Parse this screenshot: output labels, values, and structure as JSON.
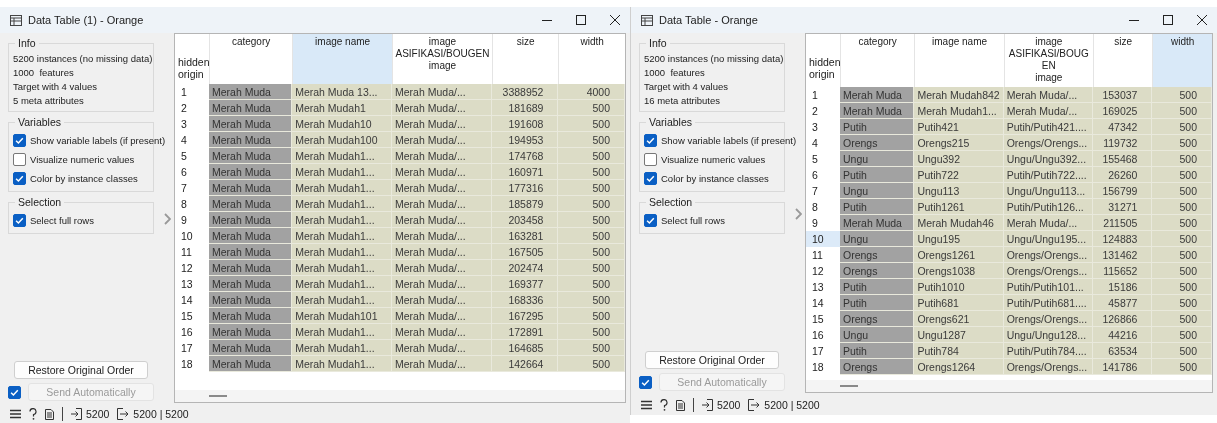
{
  "windows": [
    {
      "title": "Data Table (1) - Orange",
      "info": {
        "title": "Info",
        "lines": [
          "5200 instances (no missing data)",
          "1000  features",
          "Target with 4 values",
          "5 meta attributes"
        ]
      },
      "variables": {
        "title": "Variables",
        "options": [
          {
            "label": "Show variable labels (if present)",
            "checked": true
          },
          {
            "label": "Visualize numeric values",
            "checked": false
          },
          {
            "label": "Color by instance classes",
            "checked": true
          }
        ]
      },
      "selection": {
        "title": "Selection",
        "options": [
          {
            "label": "Select full rows",
            "checked": true
          }
        ]
      },
      "restore_button": "Restore Original Order",
      "send_automatically": {
        "label": "Send Automatically",
        "checked": true,
        "disabled": true
      },
      "table": {
        "row_header": "hidden origin",
        "columns": [
          {
            "lines": [
              "category"
            ],
            "kind": "class",
            "selected": false
          },
          {
            "lines": [
              "image name"
            ],
            "kind": "text",
            "selected": true
          },
          {
            "lines": [
              "image",
              "ASIFIKASI/BOUGEN",
              "image"
            ],
            "kind": "text",
            "selected": false
          },
          {
            "lines": [
              "size"
            ],
            "kind": "number",
            "selected": false
          },
          {
            "lines": [
              "width"
            ],
            "kind": "number",
            "selected": false
          }
        ],
        "rows": [
          {
            "number": "1",
            "selected": false,
            "cells": [
              "Merah Muda",
              "Merah Muda 13...",
              "Merah Muda/...",
              "3388952",
              "4000"
            ]
          },
          {
            "number": "2",
            "selected": false,
            "cells": [
              "Merah Muda",
              "Merah Mudah1",
              "Merah Muda/...",
              "181689",
              "500"
            ]
          },
          {
            "number": "3",
            "selected": false,
            "cells": [
              "Merah Muda",
              "Merah Mudah10",
              "Merah Muda/...",
              "191608",
              "500"
            ]
          },
          {
            "number": "4",
            "selected": false,
            "cells": [
              "Merah Muda",
              "Merah Mudah100",
              "Merah Muda/...",
              "194953",
              "500"
            ]
          },
          {
            "number": "5",
            "selected": false,
            "cells": [
              "Merah Muda",
              "Merah Mudah1...",
              "Merah Muda/...",
              "174768",
              "500"
            ]
          },
          {
            "number": "6",
            "selected": false,
            "cells": [
              "Merah Muda",
              "Merah Mudah1...",
              "Merah Muda/...",
              "160971",
              "500"
            ]
          },
          {
            "number": "7",
            "selected": false,
            "cells": [
              "Merah Muda",
              "Merah Mudah1...",
              "Merah Muda/...",
              "177316",
              "500"
            ]
          },
          {
            "number": "8",
            "selected": false,
            "cells": [
              "Merah Muda",
              "Merah Mudah1...",
              "Merah Muda/...",
              "185879",
              "500"
            ]
          },
          {
            "number": "9",
            "selected": false,
            "cells": [
              "Merah Muda",
              "Merah Mudah1...",
              "Merah Muda/...",
              "203458",
              "500"
            ]
          },
          {
            "number": "10",
            "selected": false,
            "cells": [
              "Merah Muda",
              "Merah Mudah1...",
              "Merah Muda/...",
              "163281",
              "500"
            ]
          },
          {
            "number": "11",
            "selected": false,
            "cells": [
              "Merah Muda",
              "Merah Mudah1...",
              "Merah Muda/...",
              "167505",
              "500"
            ]
          },
          {
            "number": "12",
            "selected": false,
            "cells": [
              "Merah Muda",
              "Merah Mudah1...",
              "Merah Muda/...",
              "202474",
              "500"
            ]
          },
          {
            "number": "13",
            "selected": false,
            "cells": [
              "Merah Muda",
              "Merah Mudah1...",
              "Merah Muda/...",
              "169377",
              "500"
            ]
          },
          {
            "number": "14",
            "selected": false,
            "cells": [
              "Merah Muda",
              "Merah Mudah1...",
              "Merah Muda/...",
              "168336",
              "500"
            ]
          },
          {
            "number": "15",
            "selected": false,
            "cells": [
              "Merah Muda",
              "Merah Mudah101",
              "Merah Muda/...",
              "167295",
              "500"
            ]
          },
          {
            "number": "16",
            "selected": false,
            "cells": [
              "Merah Muda",
              "Merah Mudah1...",
              "Merah Muda/...",
              "172891",
              "500"
            ]
          },
          {
            "number": "17",
            "selected": false,
            "cells": [
              "Merah Muda",
              "Merah Mudah1...",
              "Merah Muda/...",
              "164685",
              "500"
            ]
          },
          {
            "number": "18",
            "selected": false,
            "cells": [
              "Merah Muda",
              "Merah Mudah1...",
              "Merah Muda/...",
              "142664",
              "500"
            ]
          }
        ]
      },
      "status": {
        "input": "5200",
        "output": "5200 | 5200"
      }
    },
    {
      "title": "Data Table - Orange",
      "info": {
        "title": "Info",
        "lines": [
          "5200 instances (no missing data)",
          "1000  features",
          "Target with 4 values",
          "16 meta attributes"
        ]
      },
      "variables": {
        "title": "Variables",
        "options": [
          {
            "label": "Show variable labels (if present)",
            "checked": true
          },
          {
            "label": "Visualize numeric values",
            "checked": false
          },
          {
            "label": "Color by instance classes",
            "checked": true
          }
        ]
      },
      "selection": {
        "title": "Selection",
        "options": [
          {
            "label": "Select full rows",
            "checked": true
          }
        ]
      },
      "restore_button": "Restore Original Order",
      "send_automatically": {
        "label": "Send Automatically",
        "checked": true,
        "disabled": true
      },
      "table": {
        "row_header": "hidden origin",
        "columns": [
          {
            "lines": [
              "category"
            ],
            "kind": "class",
            "selected": false
          },
          {
            "lines": [
              "image name"
            ],
            "kind": "text",
            "selected": false
          },
          {
            "lines": [
              "image",
              "ASIFIKASI/BOUGEN",
              "image"
            ],
            "kind": "text",
            "selected": false
          },
          {
            "lines": [
              "size"
            ],
            "kind": "number",
            "selected": false
          },
          {
            "lines": [
              "width"
            ],
            "kind": "number",
            "selected": true
          }
        ],
        "rows": [
          {
            "number": "1",
            "selected": false,
            "cells": [
              "Merah Muda",
              "Merah Mudah842",
              "Merah Muda/...",
              "153037",
              "500"
            ]
          },
          {
            "number": "2",
            "selected": false,
            "cells": [
              "Merah Muda",
              "Merah Mudah1...",
              "Merah Muda/...",
              "169025",
              "500"
            ]
          },
          {
            "number": "3",
            "selected": false,
            "cells": [
              "Putih",
              "Putih421",
              "Putih/Putih421....",
              "47342",
              "500"
            ]
          },
          {
            "number": "4",
            "selected": false,
            "cells": [
              "Orengs",
              "Orengs215",
              "Orengs/Orengs...",
              "119732",
              "500"
            ]
          },
          {
            "number": "5",
            "selected": false,
            "cells": [
              "Ungu",
              "Ungu392",
              "Ungu/Ungu392...",
              "155468",
              "500"
            ]
          },
          {
            "number": "6",
            "selected": false,
            "cells": [
              "Putih",
              "Putih722",
              "Putih/Putih722....",
              "26260",
              "500"
            ]
          },
          {
            "number": "7",
            "selected": false,
            "cells": [
              "Ungu",
              "Ungu113",
              "Ungu/Ungu113...",
              "156799",
              "500"
            ]
          },
          {
            "number": "8",
            "selected": false,
            "cells": [
              "Putih",
              "Putih1261",
              "Putih/Putih126...",
              "31271",
              "500"
            ]
          },
          {
            "number": "9",
            "selected": false,
            "cells": [
              "Merah Muda",
              "Merah Mudah46",
              "Merah Muda/...",
              "211505",
              "500"
            ]
          },
          {
            "number": "10",
            "selected": true,
            "cells": [
              "Ungu",
              "Ungu195",
              "Ungu/Ungu195...",
              "124883",
              "500"
            ]
          },
          {
            "number": "11",
            "selected": false,
            "cells": [
              "Orengs",
              "Orengs1261",
              "Orengs/Orengs...",
              "131462",
              "500"
            ]
          },
          {
            "number": "12",
            "selected": false,
            "cells": [
              "Orengs",
              "Orengs1038",
              "Orengs/Orengs...",
              "115652",
              "500"
            ]
          },
          {
            "number": "13",
            "selected": false,
            "cells": [
              "Putih",
              "Putih1010",
              "Putih/Putih101...",
              "15186",
              "500"
            ]
          },
          {
            "number": "14",
            "selected": false,
            "cells": [
              "Putih",
              "Putih681",
              "Putih/Putih681....",
              "45877",
              "500"
            ]
          },
          {
            "number": "15",
            "selected": false,
            "cells": [
              "Orengs",
              "Orengs621",
              "Orengs/Orengs...",
              "126866",
              "500"
            ]
          },
          {
            "number": "16",
            "selected": false,
            "cells": [
              "Ungu",
              "Ungu1287",
              "Ungu/Ungu128...",
              "44216",
              "500"
            ]
          },
          {
            "number": "17",
            "selected": false,
            "cells": [
              "Putih",
              "Putih784",
              "Putih/Putih784....",
              "63534",
              "500"
            ]
          },
          {
            "number": "18",
            "selected": false,
            "cells": [
              "Orengs",
              "Orengs1264",
              "Orengs/Orengs...",
              "141786",
              "500"
            ]
          }
        ]
      },
      "status": {
        "input": "5200",
        "output": "5200 | 5200"
      }
    }
  ]
}
